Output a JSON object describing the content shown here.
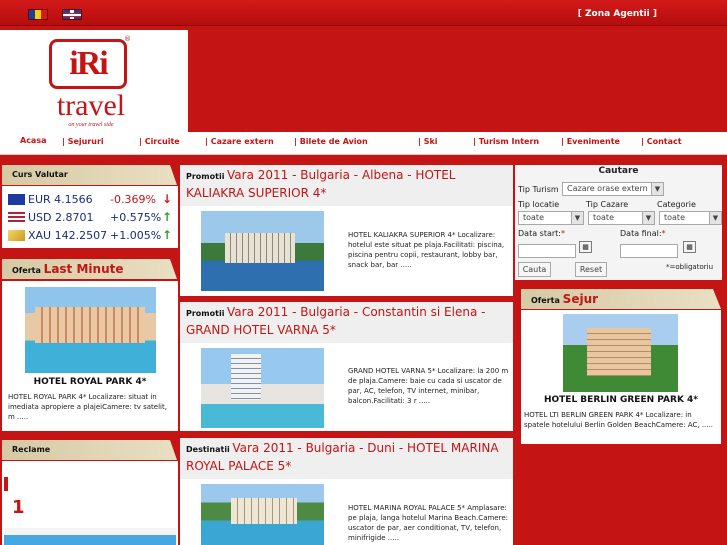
{
  "topbar": {
    "zona": "[ Zona Agentii ]"
  },
  "logo": {
    "ri": "iRi",
    "reg": "®",
    "travel": "travel",
    "tagline": "on your travel side"
  },
  "nav": [
    "Acasa",
    "| Sejururi",
    "| Circuite",
    "| Cazare extern",
    "| Bilete de Avion",
    "| Ski",
    "| Turism Intern",
    "| Evenimente",
    "| Contact"
  ],
  "curs": {
    "title": "Curs Valutar",
    "rows": [
      {
        "name": "EUR 4.1566",
        "change": "-0.369%",
        "dir": "down"
      },
      {
        "name": "USD 2.8701",
        "change": "+0.575%",
        "dir": "up"
      },
      {
        "name": "XAU 142.2507",
        "change": "+1.005%",
        "dir": "up"
      }
    ]
  },
  "last_minute": {
    "label": "Oferta",
    "title": "Last Minute",
    "hotel": "HOTEL ROYAL PARK 4*",
    "desc": "HOTEL ROYAL PARK 4* Localizare: situat in imediata apropiere a plajeiCamere: tv satelit, m ....."
  },
  "reclame": {
    "title": "Reclame",
    "badge": "1"
  },
  "offers": [
    {
      "label": "Promotii",
      "title": "Vara 2011 - Bulgaria - Albena - HOTEL KALIAKRA SUPERIOR 4*",
      "desc": "HOTEL KALIAKRA SUPERIOR 4* Localizare: hotelul este situat pe plaja.Facilitati: piscina, piscina pentru copii, restaurant, lobby bar, snack bar, bar ....."
    },
    {
      "label": "Promotii",
      "title": "Vara 2011 - Bulgaria - Constantin si Elena - GRAND HOTEL VARNA 5*",
      "desc": "GRAND HOTEL VARNA 5* Localizare: la 200 m de plaja.Camere: baie cu cada si uscator de par, AC, telefon, TV internet, minibar, balcon.Facilitati: 3 r ....."
    },
    {
      "label": "Destinatii",
      "title": "Vara 2011 - Bulgaria - Duni - HOTEL MARINA ROYAL PALACE 5*",
      "desc": "HOTEL MARINA ROYAL PALACE 5* Amplasare: pe plaja, langa hotelul Marina Beach.Camere: uscator de par, aer conditionat, TV, telefon, minifrigide ....."
    }
  ],
  "search": {
    "title": "Cautare",
    "tip_turism_label": "Tip Turism",
    "tip_turism_value": "Cazare orase extern",
    "tip_locatie_label": "Tip locatie",
    "tip_cazare_label": "Tip Cazare",
    "categorie_label": "Categorie",
    "select_toate": "toate",
    "data_start_label": "Data start:",
    "data_final_label": "Data final:",
    "required_mark": "*",
    "obligatoriu": "*=obligatoriu",
    "cauta": "Cauta",
    "reset": "Reset"
  },
  "sejur": {
    "label": "Oferta",
    "title": "Sejur",
    "hotel": "HOTEL BERLIN GREEN PARK 4*",
    "desc": "HOTEL LTI BERLIN GREEN PARK 4* Localizare: in spatele hotelului Berlin Golden BeachCamere: AC, ....."
  }
}
